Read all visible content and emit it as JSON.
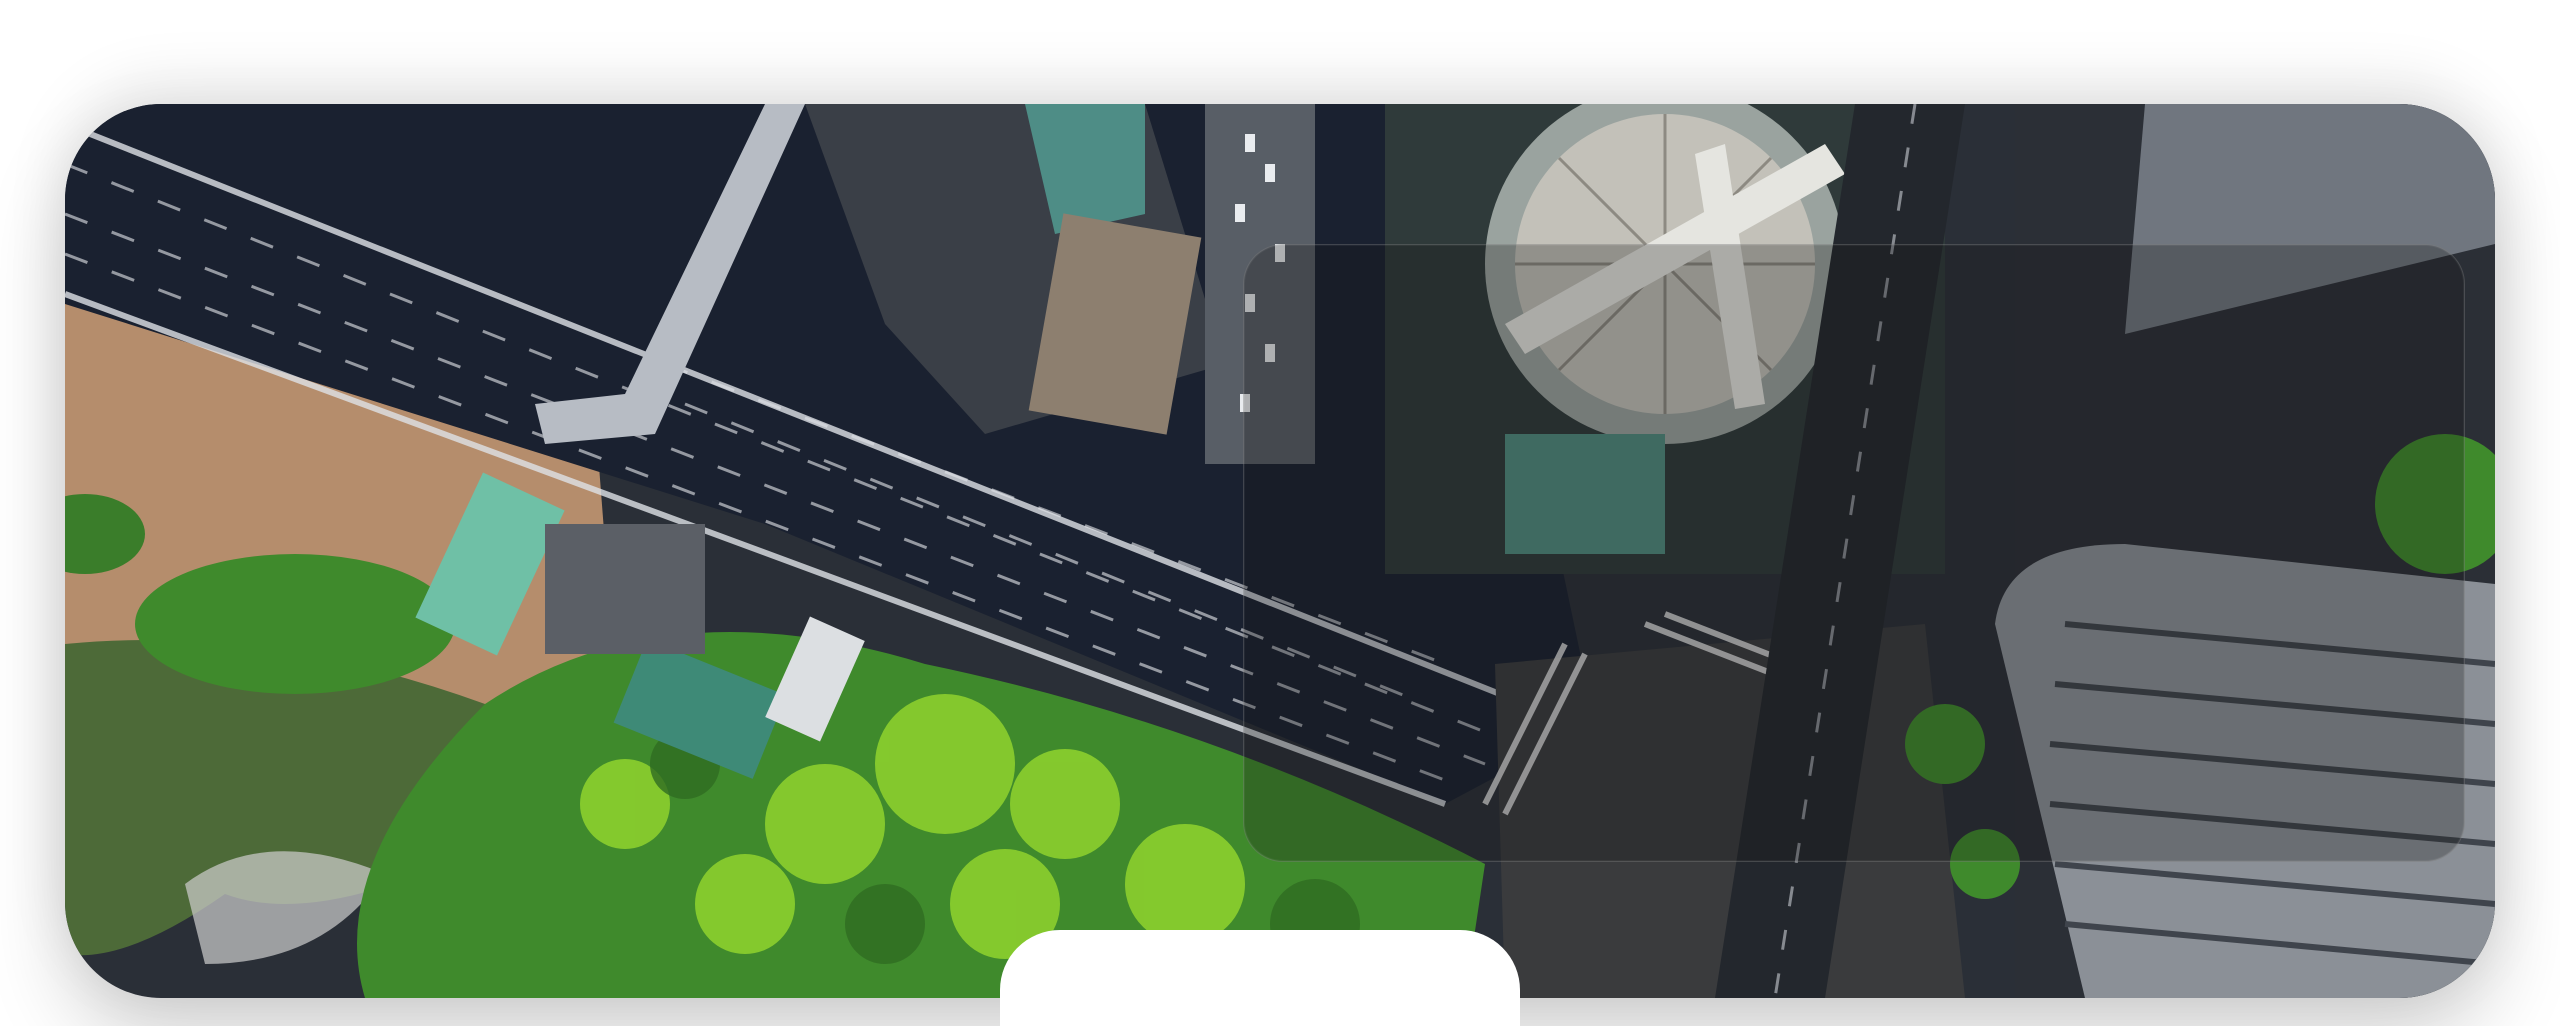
{
  "hero": {
    "image_subject": "aerial-city-intersection",
    "colors": {
      "road": "#1c2230",
      "park_green": "#3f8a2c",
      "tree_bright": "#8ccf2e",
      "pond": "#4f6b3a",
      "plaza": "#c9a27a",
      "building_dark": "#2b2f36",
      "dome": "#b9b6ae",
      "glass_overlay": "rgba(20,20,20,0.28)"
    }
  }
}
